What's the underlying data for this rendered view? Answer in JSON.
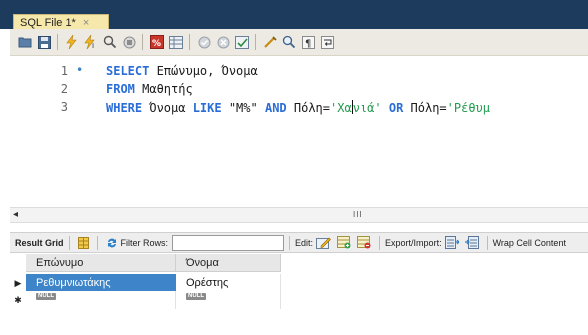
{
  "tab": {
    "title": "SQL File 1*",
    "close": "×"
  },
  "toolbar": {
    "icons": [
      "folder-open-icon",
      "save-icon",
      "execute-icon",
      "execute-current-icon",
      "explain-icon",
      "stop-icon",
      "toggle-output-icon",
      "limit-rows-icon",
      "commit-icon",
      "rollback-icon",
      "autocommit-icon",
      "beautify-icon",
      "find-icon",
      "invisible-chars-icon",
      "wrap-icon"
    ]
  },
  "editor": {
    "lines": [
      {
        "num": "1",
        "has_dot": true,
        "tokens": [
          {
            "t": "SELECT",
            "c": "kw"
          },
          {
            "t": " Επώνυμο, Όνομα",
            "c": "tx"
          }
        ]
      },
      {
        "num": "2",
        "has_dot": false,
        "tokens": [
          {
            "t": "FROM",
            "c": "kw"
          },
          {
            "t": " Μαθητής",
            "c": "tx"
          }
        ]
      },
      {
        "num": "3",
        "has_dot": false,
        "tokens": [
          {
            "t": "WHERE",
            "c": "kw"
          },
          {
            "t": " Όνομα ",
            "c": "tx"
          },
          {
            "t": "LIKE",
            "c": "kw"
          },
          {
            "t": " \"M%\" ",
            "c": "tx"
          },
          {
            "t": "AND",
            "c": "kw"
          },
          {
            "t": " Πόλη=",
            "c": "tx"
          },
          {
            "t": "'Χα",
            "c": "str"
          },
          {
            "t": "|",
            "c": "caret"
          },
          {
            "t": "νιά'",
            "c": "str"
          },
          {
            "t": " ",
            "c": "tx"
          },
          {
            "t": "OR",
            "c": "kw"
          },
          {
            "t": " Πόλη=",
            "c": "tx"
          },
          {
            "t": "'Ρέθυμ",
            "c": "str"
          }
        ]
      }
    ]
  },
  "scrollbar": {
    "left_arrow": "◂",
    "grip": "III"
  },
  "result_toolbar": {
    "result_grid": "Result Grid",
    "filter_rows": "Filter Rows:",
    "filter_value": "",
    "edit": "Edit:",
    "export_import": "Export/Import:",
    "wrap": "Wrap Cell Content"
  },
  "grid": {
    "columns": [
      "Επώνυμο",
      "Όνομα"
    ],
    "rows": [
      {
        "marker": "▶",
        "cells": [
          "Ρεθυμνιωτάκης",
          "Ορέστης"
        ]
      },
      {
        "marker": "✱",
        "cells": [
          "NULL",
          "NULL"
        ]
      }
    ]
  }
}
